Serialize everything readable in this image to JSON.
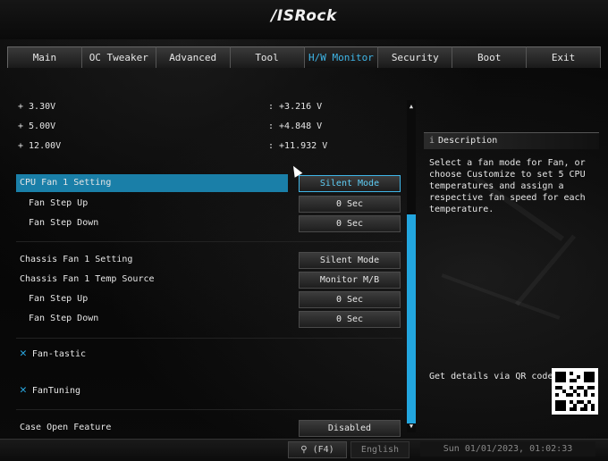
{
  "brand": "/ISRock",
  "tabs": [
    {
      "label": "Main"
    },
    {
      "label": "OC Tweaker"
    },
    {
      "label": "Advanced"
    },
    {
      "label": "Tool"
    },
    {
      "label": "H/W Monitor"
    },
    {
      "label": "Security"
    },
    {
      "label": "Boot"
    },
    {
      "label": "Exit"
    }
  ],
  "voltages": [
    {
      "label": "+ 3.30V",
      "value": ": +3.216 V"
    },
    {
      "label": "+ 5.00V",
      "value": ": +4.848 V"
    },
    {
      "label": "+ 12.00V",
      "value": ": +11.932 V"
    }
  ],
  "cpu_fan": {
    "setting_label": "CPU Fan 1 Setting",
    "setting_value": "Silent Mode",
    "step_up_label": "Fan Step Up",
    "step_up_value": "0 Sec",
    "step_down_label": "Fan Step Down",
    "step_down_value": "0 Sec"
  },
  "chassis_fan": {
    "setting_label": "Chassis Fan 1 Setting",
    "setting_value": "Silent Mode",
    "temp_label": "Chassis Fan 1 Temp Source",
    "temp_value": "Monitor M/B",
    "step_up_label": "Fan Step Up",
    "step_up_value": "0 Sec",
    "step_down_label": "Fan Step Down",
    "step_down_value": "0 Sec"
  },
  "tools": {
    "fantastic": "Fan-tastic",
    "fantuning": "FanTuning",
    "tool_icon": "wrench-icon"
  },
  "case_open": {
    "label": "Case Open Feature",
    "value": "Disabled"
  },
  "description": {
    "title": "Description",
    "text": "Select a fan mode for Fan, or choose Customize to set 5 CPU temperatures and assign a respective fan speed for each temperature."
  },
  "qr_label": "Get details via QR code",
  "bottom": {
    "search": "(F4)",
    "language": "English",
    "clock": "Sun 01/01/2023, 01:02:33"
  },
  "colors": {
    "accent": "#22a6df",
    "highlight": "#1a7fa8"
  }
}
